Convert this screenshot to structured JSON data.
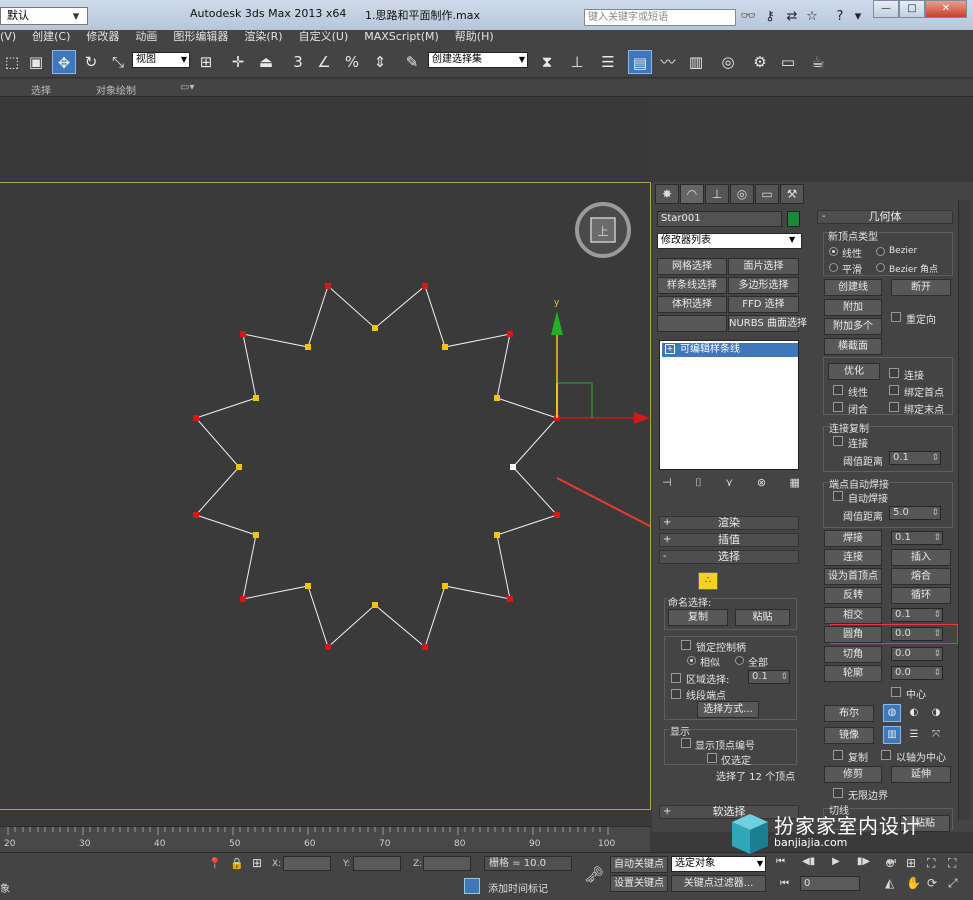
{
  "titlebar": {
    "workspace": "默认",
    "app_title": "Autodesk 3ds Max  2013 x64",
    "file_name": "1.思路和平面制作.max",
    "search_placeholder": "键入关键字或短语",
    "win_min": "—",
    "win_max": "□",
    "win_close": "✕"
  },
  "menu": {
    "items": [
      "(V)",
      "创建(C)",
      "修改器",
      "动画",
      "图形编辑器",
      "渲染(R)",
      "自定义(U)",
      "MAXScript(M)",
      "帮助(H)"
    ]
  },
  "toolbar": {
    "view_select": "视图",
    "selection_set": "创建选择集",
    "snap_3": "3",
    "snap_pct": "%"
  },
  "ribbon": {
    "tab_select": "选择",
    "tab_paint": "对象绘制"
  },
  "viewport": {
    "axis_y": "y",
    "viewcube_label": "上"
  },
  "command_panel": {
    "object_name": "Star001",
    "object_color": "#1a8a3a",
    "modifier_list": "修改器列表",
    "buttons_row1": [
      "网格选择",
      "面片选择"
    ],
    "buttons_row2": [
      "样条线选择",
      "多边形选择"
    ],
    "buttons_row3": [
      "体积选择",
      "FFD 选择"
    ],
    "buttons_row4": [
      "",
      "NURBS 曲面选择"
    ],
    "stack_item": "可编辑样条线",
    "rollouts": {
      "render": "渲染",
      "interp": "插值",
      "select": "选择",
      "soft_select": "软选择"
    },
    "selection": {
      "named_sel": "命名选择:",
      "copy": "复制",
      "paste": "粘贴",
      "lock_handles": "锁定控制柄",
      "similar": "相似",
      "all": "全部",
      "area_select": "区域选择:",
      "area_value": "0.1",
      "segment_end": "线段端点",
      "select_by": "选择方式...",
      "display": "显示",
      "show_vertex_numbers": "显示顶点编号",
      "only_selected": "仅选定",
      "status": "选择了 12 个顶点"
    },
    "geometry": {
      "title": "几何体",
      "new_vertex_type": "新顶点类型",
      "linear": "线性",
      "bezier": "Bezier",
      "smooth": "平滑",
      "bezier_corner": "Bezier 角点",
      "create_line": "创建线",
      "break": "断开",
      "attach": "附加",
      "attach_multiple": "附加多个",
      "reorient": "重定向",
      "cross_section": "横截面",
      "refine": "优化",
      "connect": "连接",
      "linear2": "线性",
      "bind_first": "绑定首点",
      "closed": "闭合",
      "bind_last": "绑定末点",
      "connect_copy": "连接复制",
      "connect2": "连接",
      "threshold": "阈值距离",
      "threshold_value": "0.1",
      "end_auto_weld": "端点自动焊接",
      "auto_weld": "自动焊接",
      "threshold2": "阈值距离",
      "threshold2_value": "5.0",
      "weld": "焊接",
      "weld_value": "0.1",
      "connect_btn": "连接",
      "insert": "插入",
      "make_first": "设为首顶点",
      "fuse": "熔合",
      "reverse": "反转",
      "cycle": "循环",
      "cross_insert": "相交",
      "cross_value": "0.1",
      "fillet": "圆角",
      "fillet_value": "0.0",
      "chamfer": "切角",
      "chamfer_value": "0.0",
      "outline": "轮廓",
      "outline_value": "0.0",
      "center": "中心",
      "boolean": "布尔",
      "mirror": "镜像",
      "copy": "复制",
      "about_pivot": "以轴为中心",
      "trim": "修剪",
      "extend": "延伸",
      "infinite_bounds": "无限边界",
      "tangent": "切线",
      "paste_btn": "粘贴"
    }
  },
  "timeline": {
    "ticks": [
      "20",
      "30",
      "40",
      "50",
      "60",
      "70",
      "80",
      "90",
      "100"
    ]
  },
  "status": {
    "x_label": "X:",
    "y_label": "Y:",
    "z_label": "Z:",
    "grid": "栅格 = 10.0",
    "auto_key": "自动关键点",
    "selected_obj": "选定对象",
    "set_key": "设置关键点",
    "key_filter": "关键点过滤器...",
    "add_time_tag": "添加时间标记",
    "frame_value": "0",
    "left_status": "象"
  },
  "watermark": {
    "title": "扮家家室内设计",
    "url": "banjiajia.com"
  }
}
